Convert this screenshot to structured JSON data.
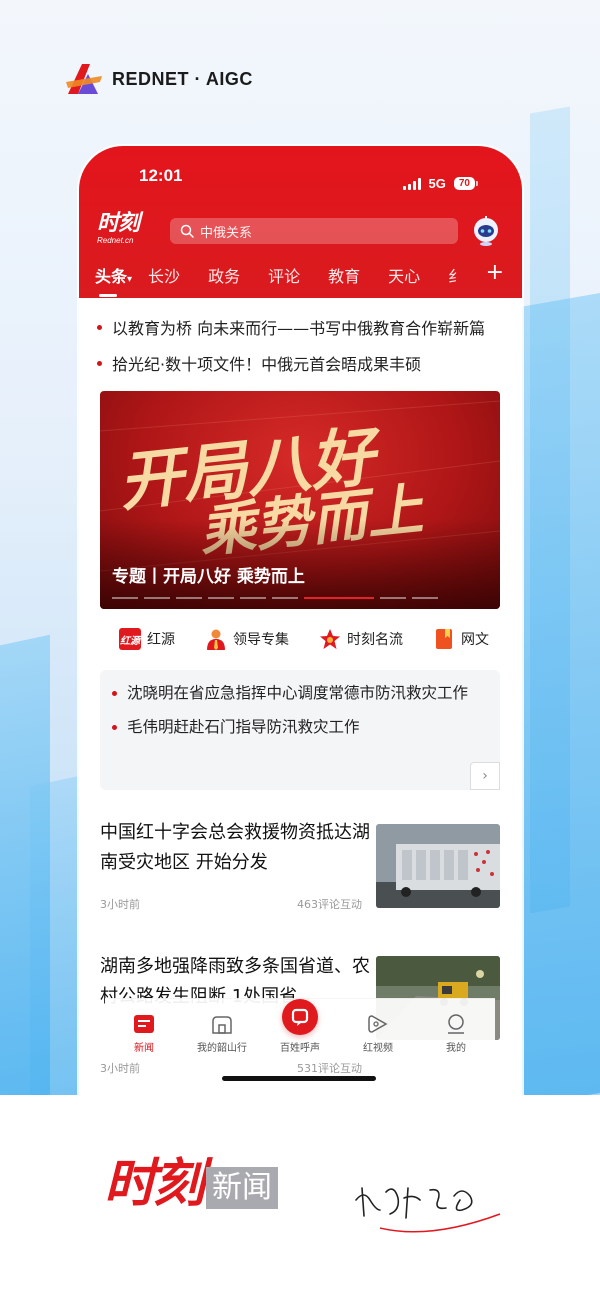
{
  "brand": {
    "name": "REDNET · AIGC"
  },
  "status": {
    "time": "12:01",
    "network": "5G",
    "battery": "70"
  },
  "app": {
    "logo_main": "时刻",
    "logo_sub": "Rednet.cn"
  },
  "search": {
    "placeholder": "中俄关系"
  },
  "channels": [
    "头条",
    "长沙",
    "政务",
    "评论",
    "教育",
    "天心",
    "纟"
  ],
  "headlines": [
    "以教育为桥 向未来而行——书写中俄教育合作崭新篇",
    "拾光纪·数十项文件！中俄元首会晤成果丰硕"
  ],
  "banner": {
    "art_line1": "开局八好",
    "art_line2": "乘势而上",
    "caption": "专题丨开局八好 乘势而上",
    "slide_index": 6,
    "slide_count": 9
  },
  "quick_links": [
    {
      "label": "红源",
      "icon": "hongyuan-icon",
      "icon_text": "红源",
      "color": "#e0191f"
    },
    {
      "label": "领导专集",
      "icon": "leader-icon",
      "icon_text": "",
      "color": "#e8541c"
    },
    {
      "label": "时刻名流",
      "icon": "star-icon",
      "icon_text": "",
      "color": "#e0191f"
    },
    {
      "label": "网文",
      "icon": "bookmark-icon",
      "icon_text": "",
      "color": "#f0521f"
    }
  ],
  "notices": [
    "沈晓明在省应急指挥中心调度常德市防汛救灾工作",
    "毛伟明赶赴石门指导防汛救灾工作"
  ],
  "news": [
    {
      "title": "中国红十字会总会救援物资抵达湖南受灾地区 开始分发",
      "time": "3小时前",
      "comments": "463评论互动"
    },
    {
      "title": "湖南多地强降雨致多条国省道、农村公路发生阻断 1处国省",
      "time": "3小时前",
      "comments": "531评论互动"
    }
  ],
  "tabs": [
    {
      "label": "新闻",
      "icon": "news-tab-icon"
    },
    {
      "label": "我的韶山行",
      "icon": "home-tab-icon"
    },
    {
      "label": "百姓呼声",
      "icon": "voice-tab-icon"
    },
    {
      "label": "红视频",
      "icon": "video-tab-icon"
    },
    {
      "label": "我的",
      "icon": "profile-tab-icon"
    }
  ],
  "bottom_brand": {
    "main": "时刻",
    "sub": "新闻"
  },
  "colors": {
    "accent": "#e0191f",
    "header": "#d91b1f"
  }
}
